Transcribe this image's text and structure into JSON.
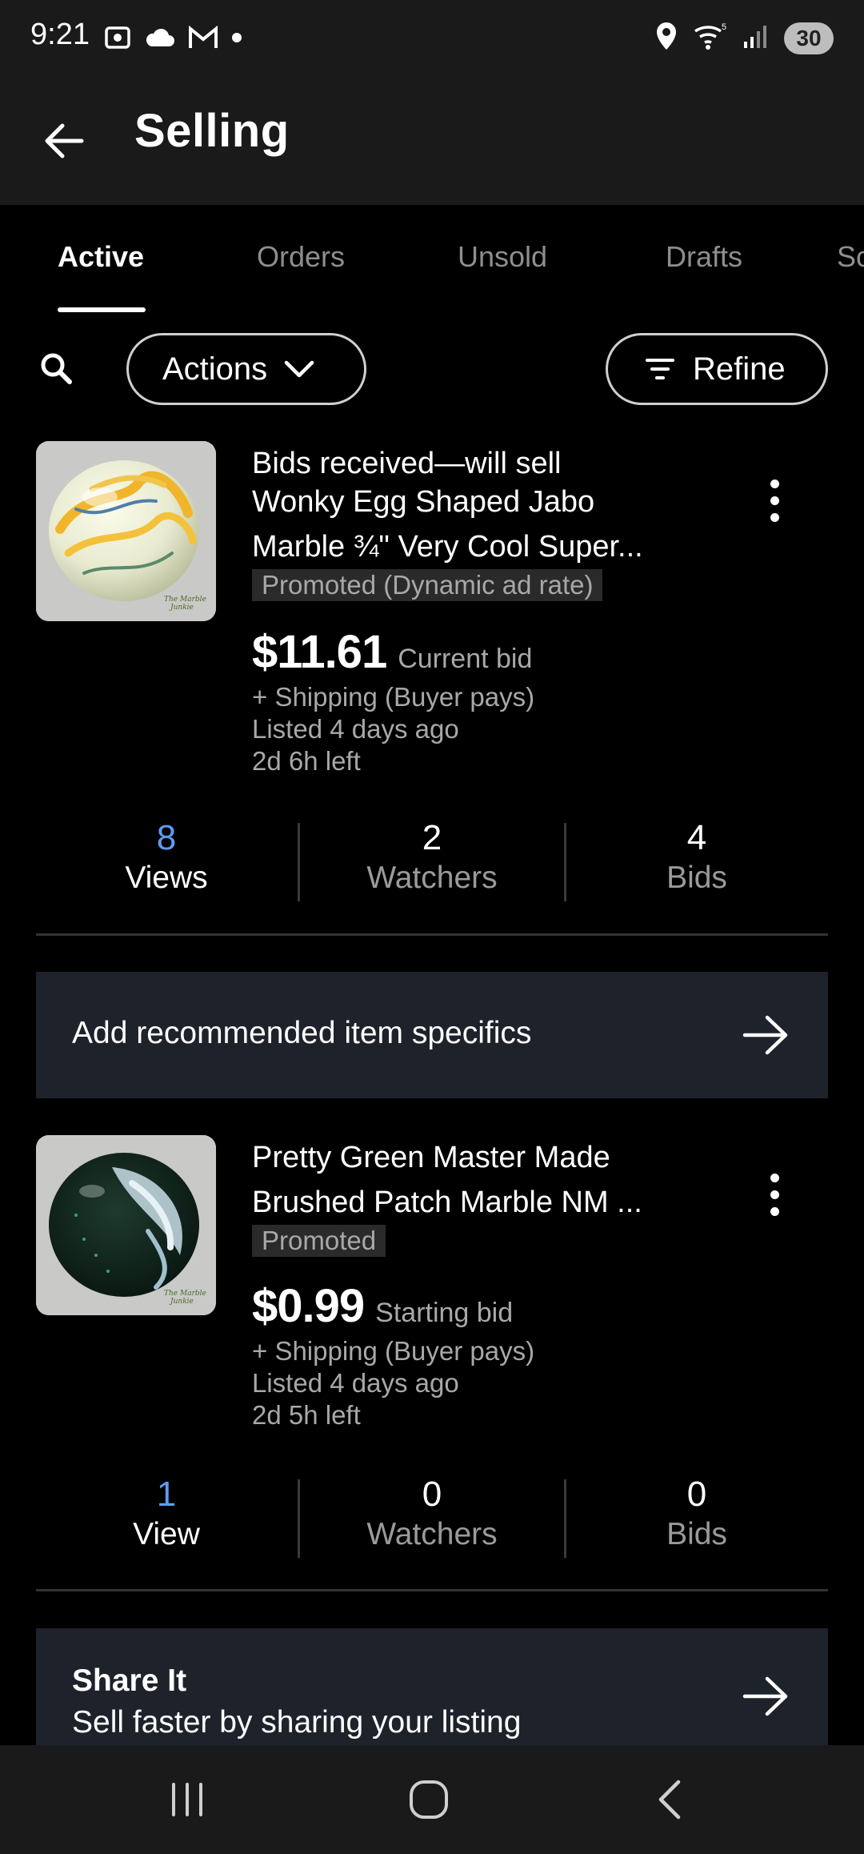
{
  "status_bar": {
    "time": "9:21",
    "battery": "30",
    "left_icons": [
      "screenshot-icon",
      "cloud-icon",
      "gmail-icon",
      "dot-icon"
    ],
    "right_icons": [
      "location-icon",
      "wifi-icon",
      "signal-icon",
      "battery-icon"
    ]
  },
  "header": {
    "title": "Selling"
  },
  "tabs": [
    {
      "label": "Active",
      "active": true
    },
    {
      "label": "Orders",
      "active": false
    },
    {
      "label": "Unsold",
      "active": false
    },
    {
      "label": "Drafts",
      "active": false
    },
    {
      "label": "Sc",
      "active": false
    }
  ],
  "toolbar": {
    "actions_label": "Actions",
    "refine_label": "Refine"
  },
  "listings": [
    {
      "title_line1": "Bids received—will sell",
      "title_line2": "Wonky Egg Shaped Jabo",
      "title_line3": "Marble ¾\" Very Cool Super...",
      "badge": "Promoted (Dynamic ad rate)",
      "price": "$11.61",
      "price_label": "Current bid",
      "shipping": "+ Shipping (Buyer pays)",
      "listed": "Listed 4 days ago",
      "time_left": "2d 6h left",
      "stats": [
        {
          "value": "8",
          "label": "Views"
        },
        {
          "value": "2",
          "label": "Watchers"
        },
        {
          "value": "4",
          "label": "Bids"
        }
      ],
      "watermark": "The Marble Junkie"
    },
    {
      "title_line1": "Pretty Green Master Made",
      "title_line2": "Brushed Patch Marble NM ...",
      "badge": "Promoted",
      "price": "$0.99",
      "price_label": "Starting bid",
      "shipping": "+ Shipping (Buyer pays)",
      "listed": "Listed 4 days ago",
      "time_left": "2d 5h left",
      "stats": [
        {
          "value": "1",
          "label": "View"
        },
        {
          "value": "0",
          "label": "Watchers"
        },
        {
          "value": "0",
          "label": "Bids"
        }
      ],
      "watermark": "The Marble Junkie"
    }
  ],
  "cta_specifics": {
    "label": "Add recommended item specifics"
  },
  "cta_share": {
    "title": "Share It",
    "subtitle": "Sell faster by sharing your listing"
  },
  "colors": {
    "accent_blue": "#5f9bf1",
    "cta_bg": "#1e232b",
    "background": "#000000"
  },
  "nav_bar": {
    "icons": [
      "recents-icon",
      "home-icon",
      "back-nav-icon"
    ]
  }
}
